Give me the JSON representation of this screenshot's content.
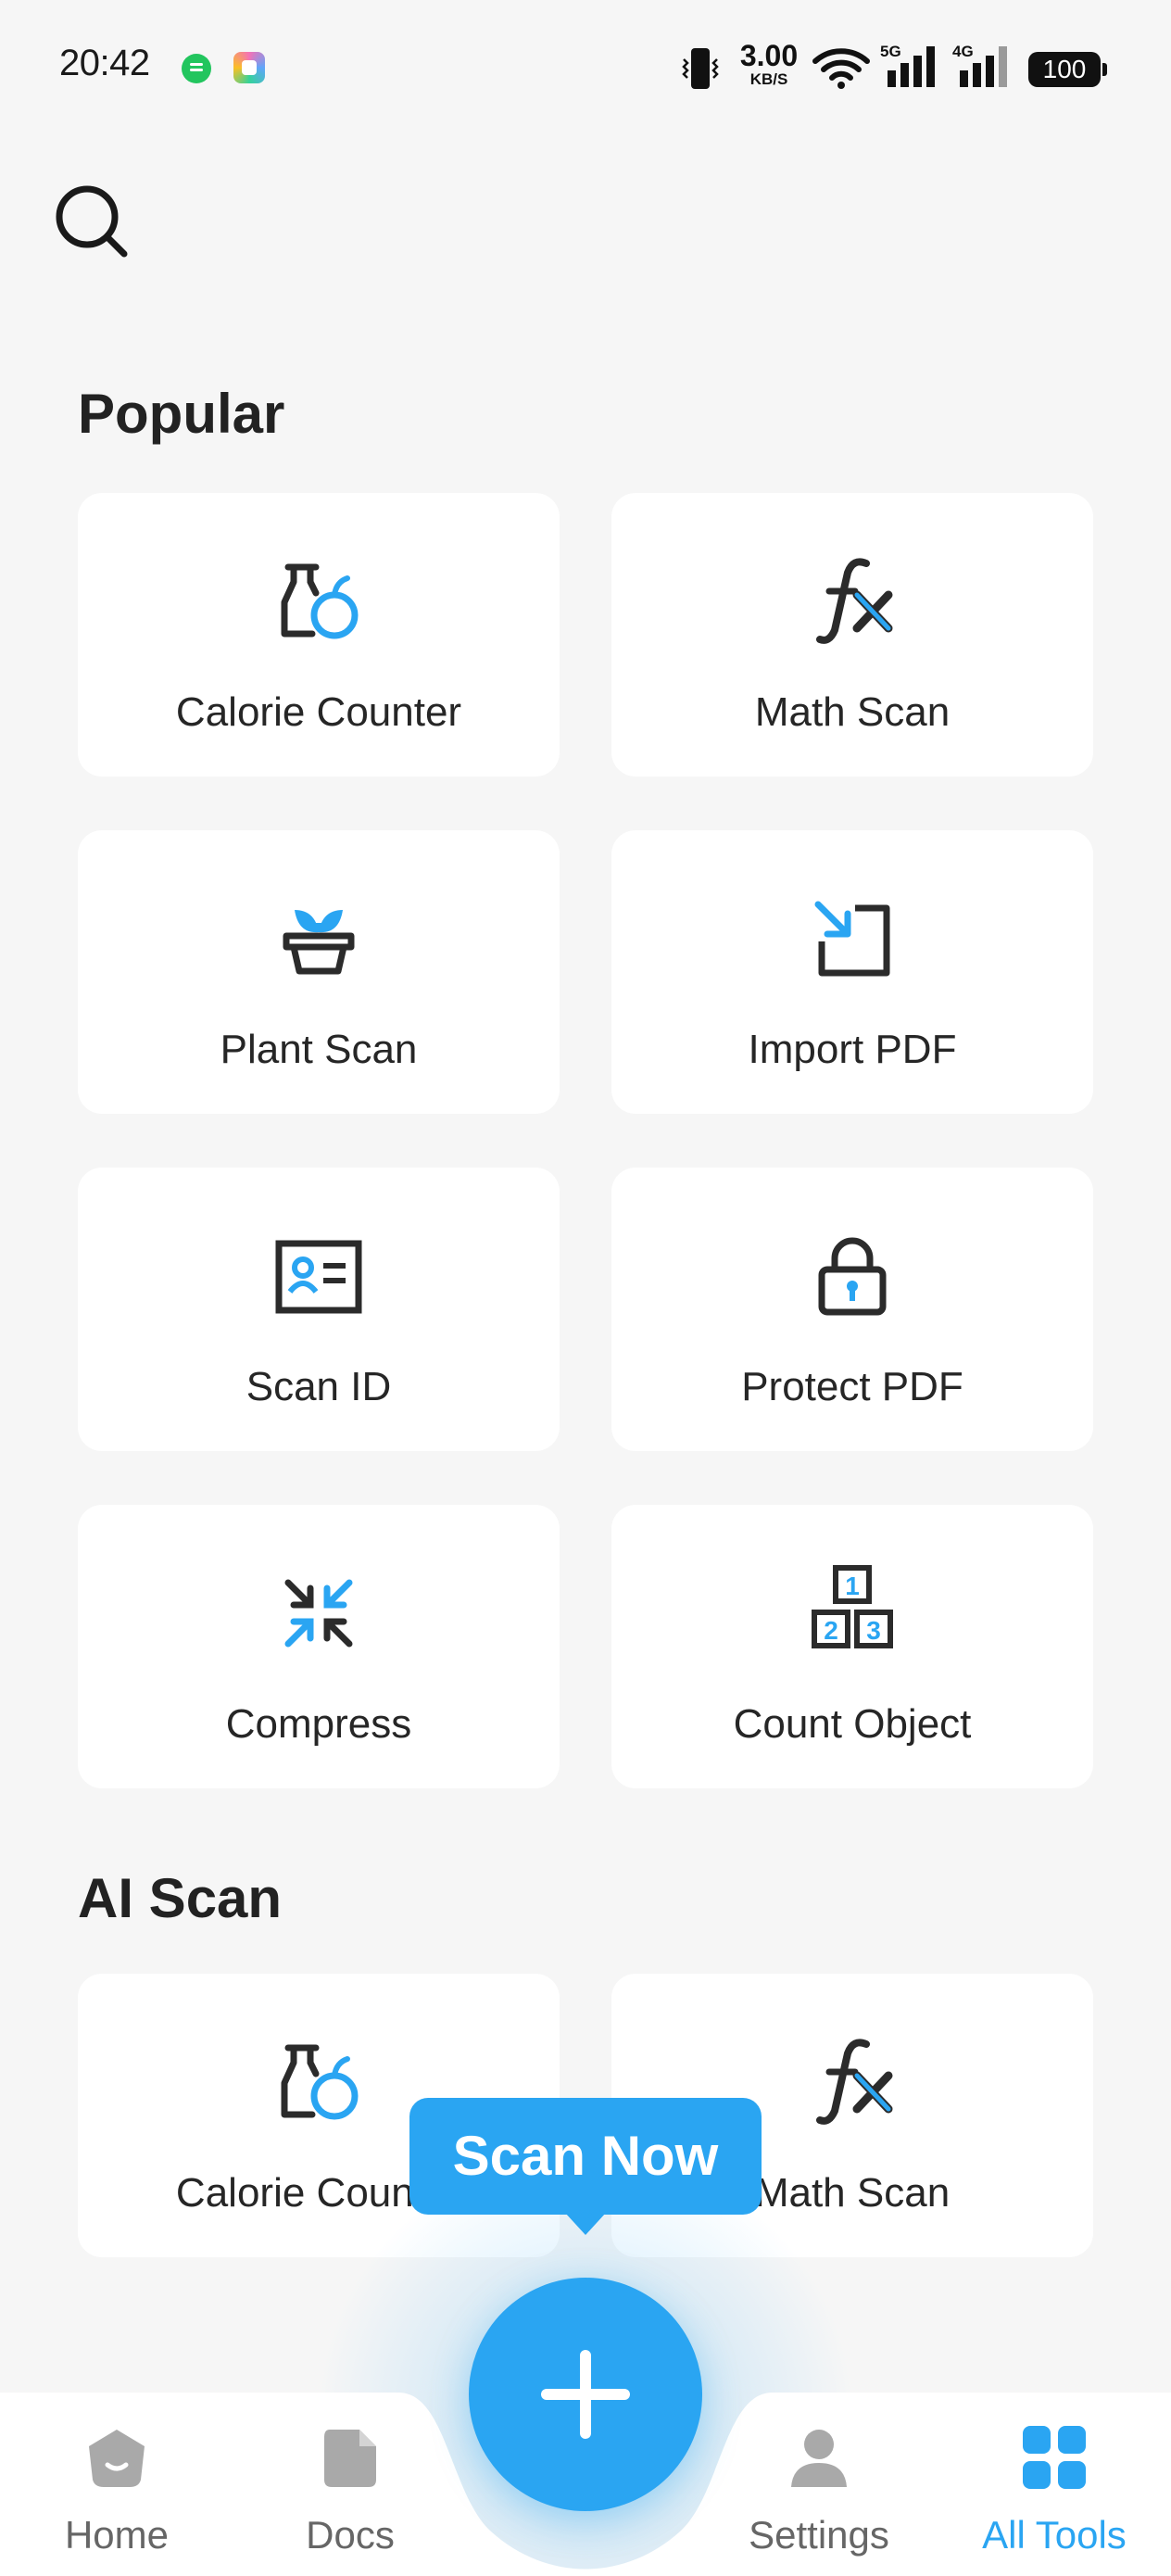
{
  "status_bar": {
    "time": "20:42",
    "net_speed_value": "3.00",
    "net_speed_unit": "KB/S",
    "signal_1_tag": "5G",
    "signal_2_tag": "4G",
    "battery": "100"
  },
  "colors": {
    "accent": "#2aa5f2",
    "icon_dark": "#2b2b2b",
    "background": "#f6f6f6",
    "card": "#ffffff"
  },
  "sections": {
    "popular": {
      "title": "Popular",
      "tools": [
        {
          "label": "Calorie Counter",
          "icon": "calorie-icon"
        },
        {
          "label": "Math Scan",
          "icon": "math-fx-icon"
        },
        {
          "label": "Plant Scan",
          "icon": "plant-icon"
        },
        {
          "label": "Import PDF",
          "icon": "import-icon"
        },
        {
          "label": "Scan ID",
          "icon": "id-card-icon"
        },
        {
          "label": "Protect PDF",
          "icon": "lock-icon"
        },
        {
          "label": "Compress",
          "icon": "compress-icon"
        },
        {
          "label": "Count Object",
          "icon": "count-blocks-icon"
        }
      ]
    },
    "ai_scan": {
      "title": "AI Scan",
      "tools": [
        {
          "label": "Calorie Counter",
          "icon": "calorie-icon"
        },
        {
          "label": "Math Scan",
          "icon": "math-fx-icon"
        }
      ]
    }
  },
  "scan_tooltip": "Scan Now",
  "bottom_nav": {
    "items": [
      {
        "label": "Home",
        "icon": "home-icon"
      },
      {
        "label": "Docs",
        "icon": "docs-icon"
      },
      {
        "label": "Settings",
        "icon": "settings-person-icon"
      },
      {
        "label": "All Tools",
        "icon": "all-tools-grid-icon"
      }
    ],
    "active": "All Tools",
    "fab_icon": "plus-icon"
  }
}
